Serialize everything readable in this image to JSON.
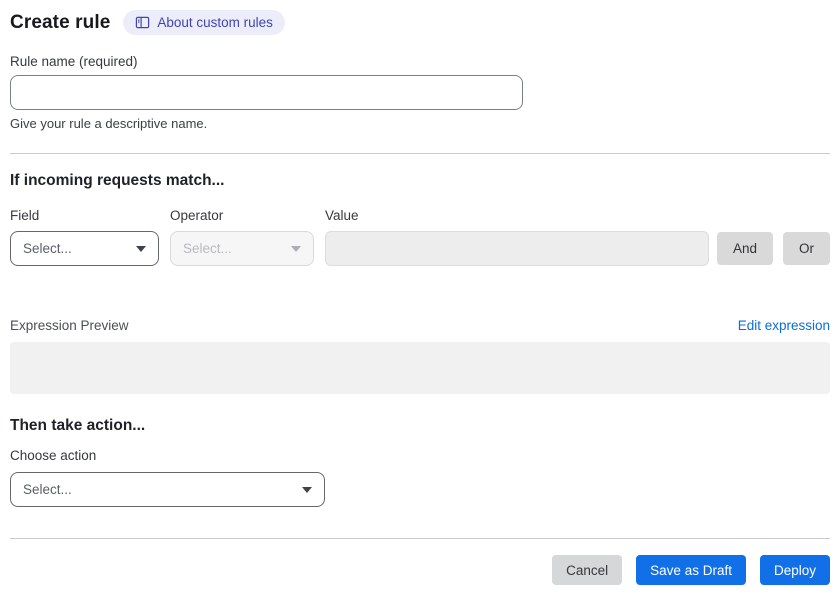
{
  "header": {
    "title": "Create rule",
    "about_link_label": "About custom rules"
  },
  "rule_name": {
    "label": "Rule name (required)",
    "value": "",
    "help": "Give your rule a descriptive name."
  },
  "match_section": {
    "title": "If incoming requests match...",
    "field_label": "Field",
    "field_value": "Select...",
    "operator_label": "Operator",
    "operator_value": "Select...",
    "value_label": "Value",
    "value_value": "",
    "and_label": "And",
    "or_label": "Or",
    "expression_preview_label": "Expression Preview",
    "expression_preview_value": "",
    "edit_expression_label": "Edit expression"
  },
  "action_section": {
    "title": "Then take action...",
    "choose_label": "Choose action",
    "action_value": "Select..."
  },
  "footer": {
    "cancel_label": "Cancel",
    "save_draft_label": "Save as Draft",
    "deploy_label": "Deploy"
  },
  "colors": {
    "primary_blue": "#1170e8",
    "link_blue": "#0b6dd9",
    "badge_bg": "#ecedf8",
    "badge_text": "#3f45b2",
    "divider": "#c9cbcd",
    "disabled_bg": "#ededee"
  }
}
